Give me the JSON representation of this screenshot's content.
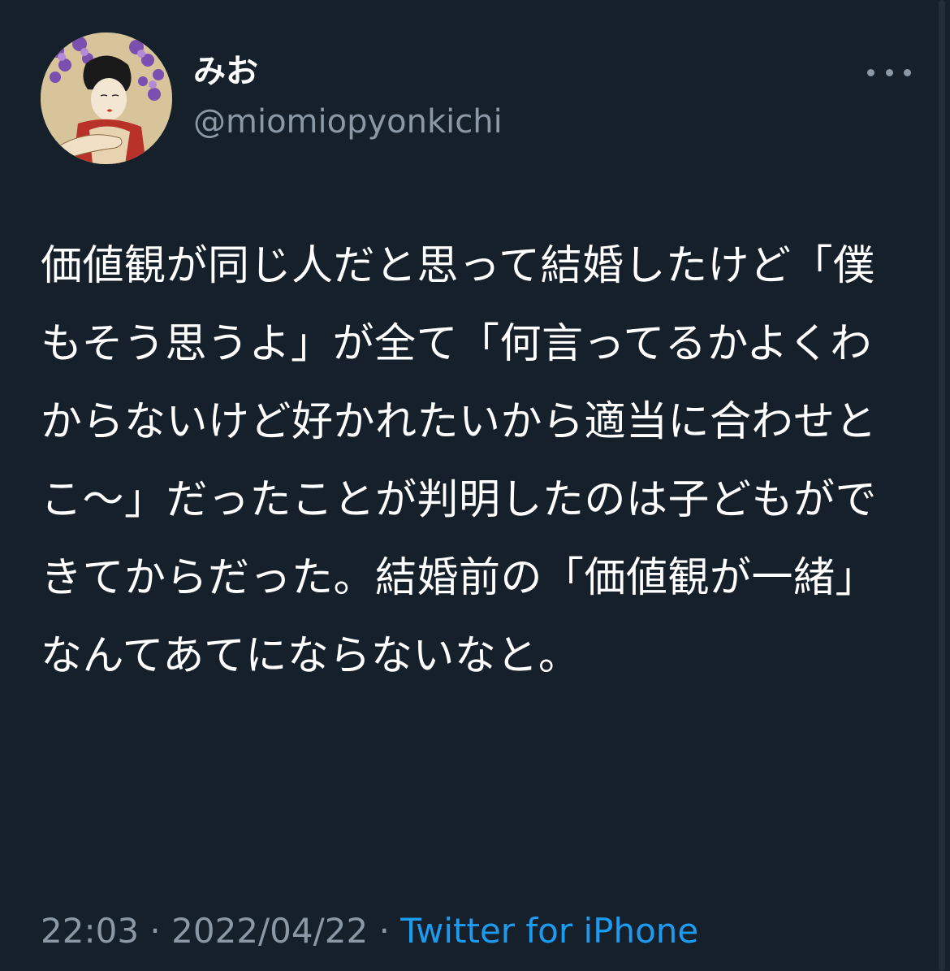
{
  "colors": {
    "background": "#15202b",
    "text_primary": "#ffffff",
    "text_secondary": "#8b98a5",
    "link": "#1d9bf0"
  },
  "user": {
    "display_name": "みお",
    "handle": "@miomiopyonkichi",
    "avatar_icon": "avatar-illustration"
  },
  "tweet": {
    "text": "価値観が同じ人だと思って結婚したけど「僕もそう思うよ」が全て「何言ってるかよくわからないけど好かれたいから適当に合わせとこ〜」だったことが判明したのは子どもができてからだった。結婚前の「価値観が一緒」なんてあてにならないなと。",
    "time": "22:03",
    "separator": "·",
    "date": "2022/04/22",
    "source": "Twitter for iPhone"
  },
  "more_icon": "more-horizontal-icon"
}
